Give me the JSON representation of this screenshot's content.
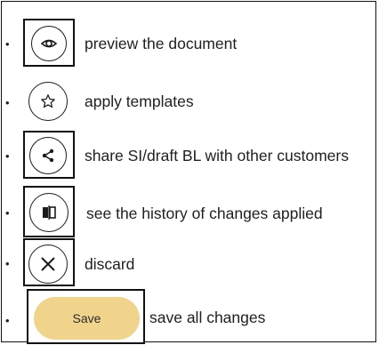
{
  "bullet_char": "•",
  "items": [
    {
      "icon": "eye-icon",
      "label": "preview the document"
    },
    {
      "icon": "star-icon",
      "label": "apply templates"
    },
    {
      "icon": "share-icon",
      "label": "share SI/draft BL with other customers"
    },
    {
      "icon": "history-icon",
      "label": "see the history of changes applied"
    },
    {
      "icon": "close-icon",
      "label": "discard"
    }
  ],
  "save": {
    "button_label": "Save",
    "description": "save all changes",
    "button_color": "#f1d48c"
  }
}
